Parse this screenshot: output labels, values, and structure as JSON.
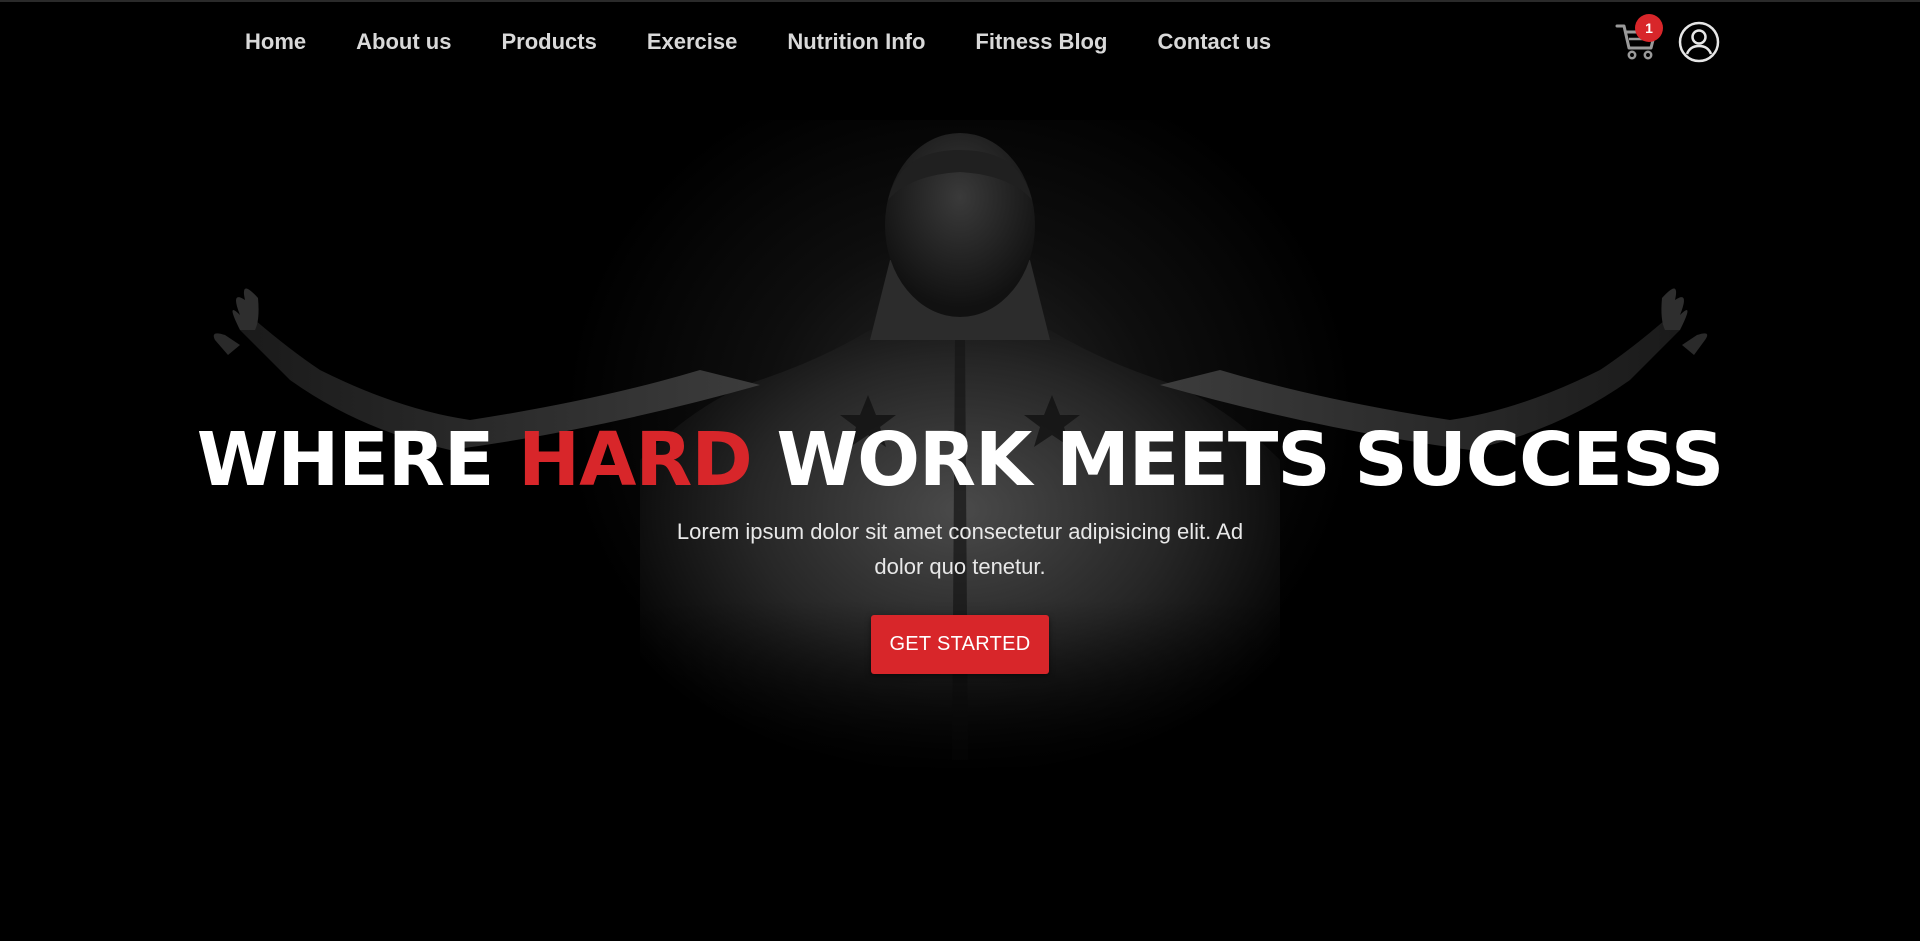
{
  "nav": {
    "links": [
      "Home",
      "About us",
      "Products",
      "Exercise",
      "Nutrition Info",
      "Fitness Blog",
      "Contact us"
    ]
  },
  "cart": {
    "icon": "cart-icon",
    "count": "1"
  },
  "profile": {
    "icon": "user-circle-icon"
  },
  "hero": {
    "title_part1": "WHERE ",
    "title_accent": "HARD",
    "title_part2": " WORK MEETS SUCCESS",
    "subtitle": "Lorem ipsum dolor sit amet consectetur adipisicing elit. Ad dolor quo tenetur.",
    "cta_label": "GET STARTED"
  },
  "colors": {
    "background": "#000000",
    "accent": "#d8262a",
    "text": "#ffffff",
    "nav_text": "#d9d9d9"
  }
}
